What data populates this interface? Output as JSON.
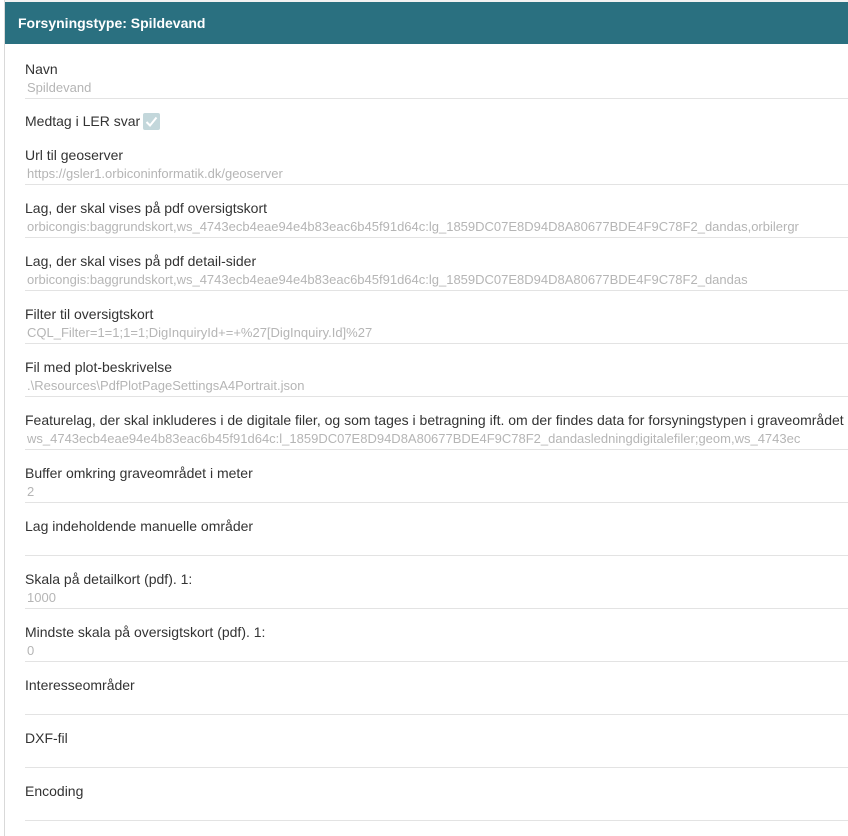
{
  "header": {
    "title": "Forsyningstype: Spildevand"
  },
  "fields": {
    "navn": {
      "label": "Navn",
      "value": "Spildevand"
    },
    "medtag": {
      "label": "Medtag i LER svar",
      "checked": true
    },
    "url": {
      "label": "Url til geoserver",
      "value": "https://gsler1.orbiconinformatik.dk/geoserver"
    },
    "lag_oversigt": {
      "label": "Lag, der skal vises på pdf oversigtskort",
      "value": "orbicongis:baggrundskort,ws_4743ecb4eae94e4b83eac6b45f91d64c:lg_1859DC07E8D94D8A80677BDE4F9C78F2_dandas,orbilergr"
    },
    "lag_detail": {
      "label": "Lag, der skal vises på pdf detail-sider",
      "value": "orbicongis:baggrundskort,ws_4743ecb4eae94e4b83eac6b45f91d64c:lg_1859DC07E8D94D8A80677BDE4F9C78F2_dandas"
    },
    "filter": {
      "label": "Filter til oversigtskort",
      "value": "CQL_Filter=1=1;1=1;DigInquiryId+=+%27[DigInquiry.Id]%27"
    },
    "plot": {
      "label": "Fil med plot-beskrivelse",
      "value": ".\\Resources\\PdfPlotPageSettingsA4Portrait.json"
    },
    "featurelag": {
      "label": "Featurelag, der skal inkluderes i de digitale filer, og som tages i betragning ift. om der findes data for forsyningstypen i graveområdet",
      "value": "ws_4743ecb4eae94e4b83eac6b45f91d64c:l_1859DC07E8D94D8A80677BDE4F9C78F2_dandasledningdigitalefiler;geom,ws_4743ec"
    },
    "buffer": {
      "label": "Buffer omkring graveområdet i meter",
      "value": "2"
    },
    "manuelle": {
      "label": "Lag indeholdende manuelle områder",
      "value": ""
    },
    "skala_detail": {
      "label": "Skala på detailkort (pdf). 1:",
      "value": "1000"
    },
    "skala_oversigt": {
      "label": "Mindste skala på oversigtskort (pdf). 1:",
      "value": "0"
    },
    "interesse": {
      "label": "Interesseområder",
      "value": ""
    },
    "dxf": {
      "label": "DXF-fil",
      "value": ""
    },
    "encoding": {
      "label": "Encoding",
      "value": ""
    }
  }
}
